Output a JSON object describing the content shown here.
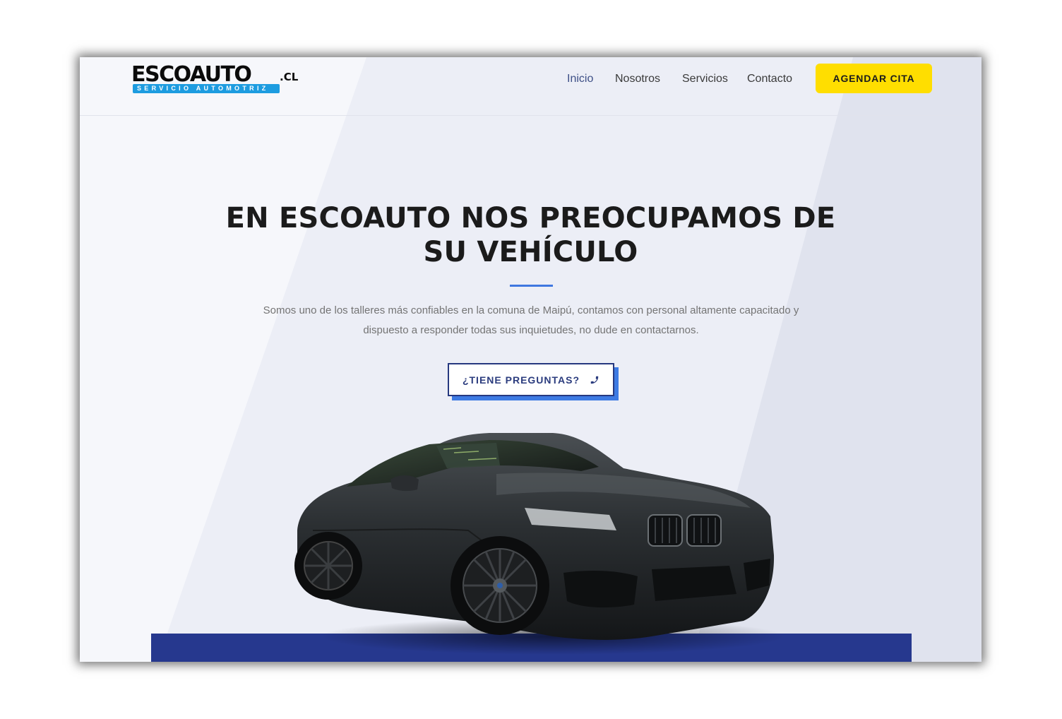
{
  "brand": {
    "name": "ESCOAUTO",
    "ext": ".CL",
    "tagline": "SERVICIO AUTOMOTRIZ",
    "tagline_color": "#1d9ce0"
  },
  "nav": {
    "items": [
      {
        "label": "Inicio",
        "active": true
      },
      {
        "label": "Nosotros",
        "active": false
      },
      {
        "label": "Servicios",
        "active": false
      },
      {
        "label": "Contacto",
        "active": false
      }
    ],
    "cta_label": "AGENDAR CITA",
    "cta_color": "#ffde00"
  },
  "hero": {
    "title_line1": "EN ESCOAUTO NOS PREOCUPAMOS DE",
    "title_line2": "SU VEHÍCULO",
    "text_line1": "Somos uno de los talleres más confiables en la comuna de Maipú, contamos con personal altamente capacitado y",
    "text_line2": "dispuesto a responder todas sus inquietudes, no dude en contactarnos.",
    "button_label": "¿TIENE PREGUNTAS?",
    "button_icon": "phone-icon",
    "accent_color": "#3f77e0",
    "primary_color": "#26388e"
  }
}
